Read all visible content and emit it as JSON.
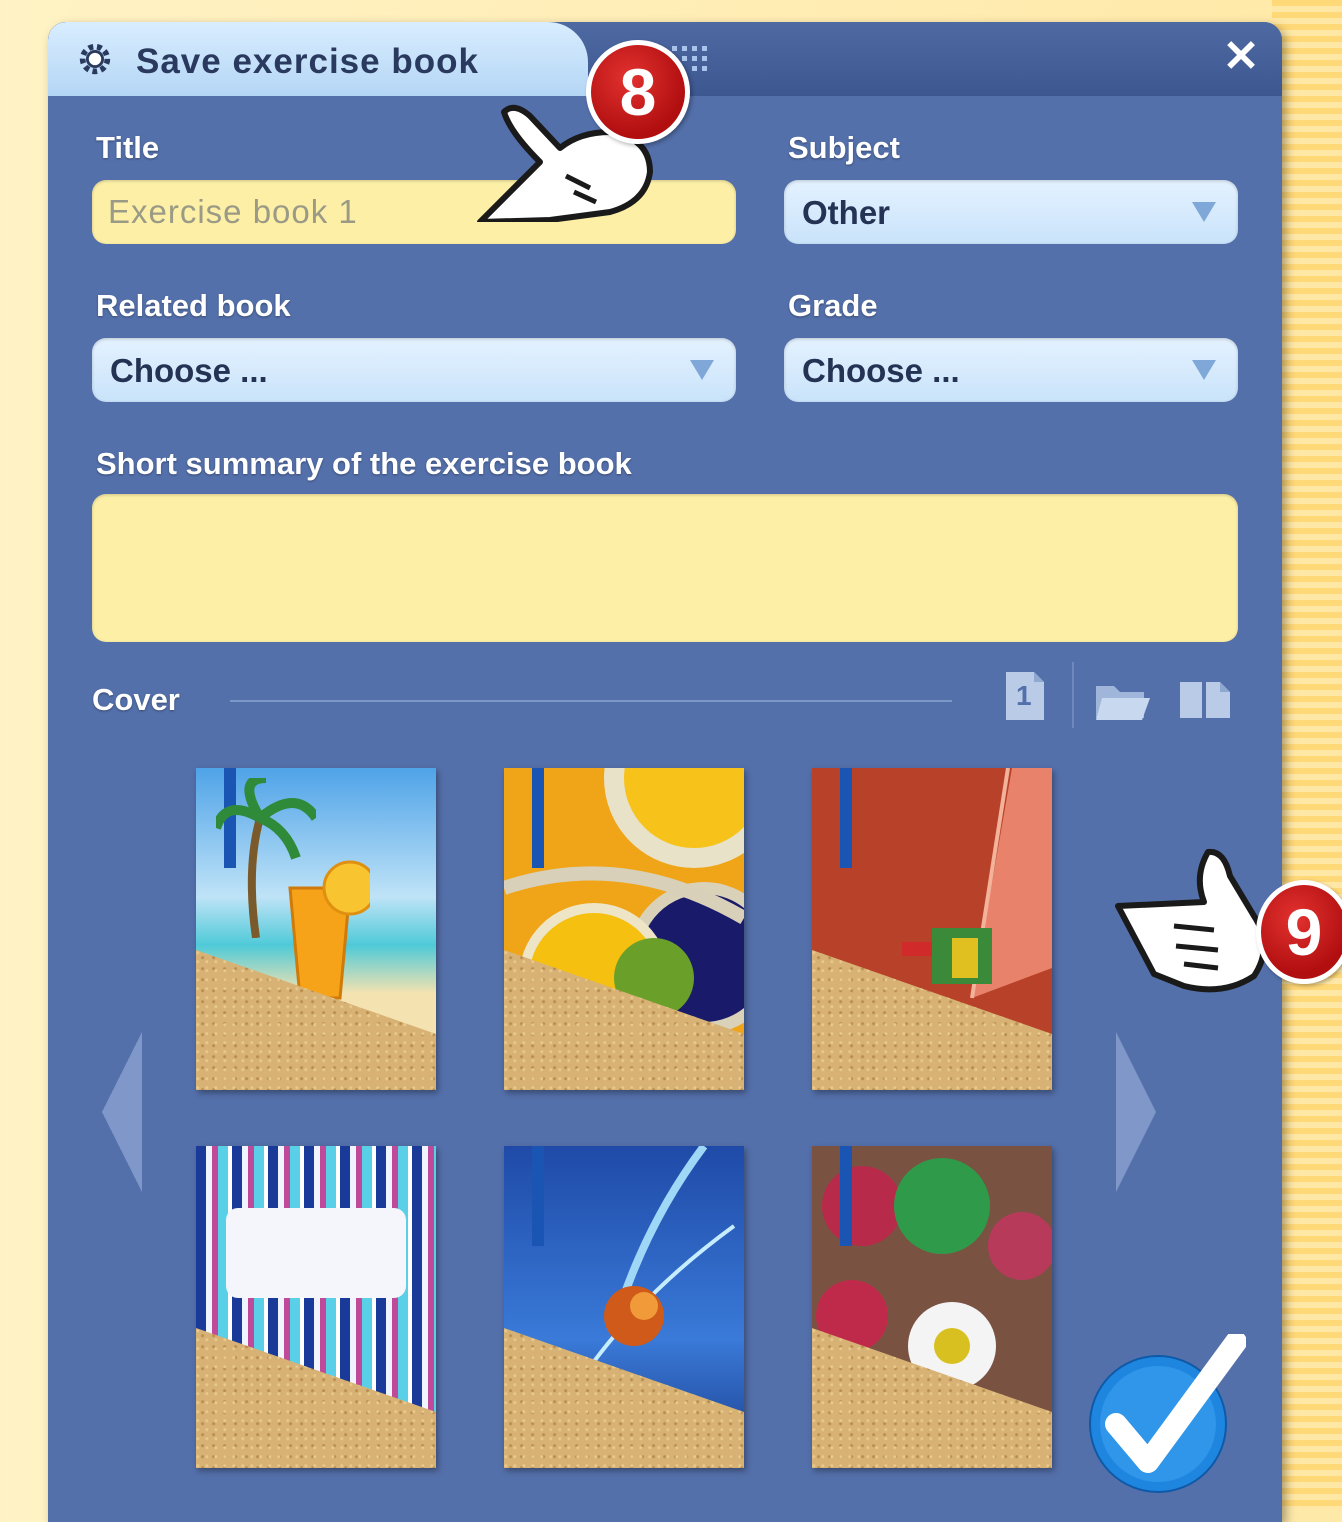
{
  "dialog": {
    "title": "Save exercise book",
    "close_glyph": "✕"
  },
  "form": {
    "title_label": "Title",
    "title_placeholder": "Exercise book 1",
    "subject_label": "Subject",
    "subject_value": "Other",
    "related_book_label": "Related book",
    "related_book_value": "Choose ...",
    "grade_label": "Grade",
    "grade_value": "Choose ...",
    "summary_label": "Short summary of the exercise book",
    "summary_value": ""
  },
  "cover": {
    "label": "Cover",
    "page_number": "1",
    "items": [
      {
        "name": "beach drink"
      },
      {
        "name": "abstract circles"
      },
      {
        "name": "red abstract"
      },
      {
        "name": "stripes"
      },
      {
        "name": "blue splash"
      },
      {
        "name": "frosted leaves"
      }
    ]
  },
  "callouts": {
    "step_8": "8",
    "step_9": "9"
  },
  "icons": [
    "gear-icon",
    "dots-icon",
    "close-icon",
    "page-number-icon",
    "folder-open-icon",
    "page-icon",
    "chevron-left-icon",
    "chevron-right-icon",
    "checkmark-icon",
    "pointing-hand-icon"
  ],
  "colors": {
    "window_bg": "#5470ab",
    "tab_bg": "#c8e2fa",
    "input_yellow": "#fdf0a6",
    "badge_red": "#c9161a",
    "confirm_blue": "#1f86e0"
  }
}
